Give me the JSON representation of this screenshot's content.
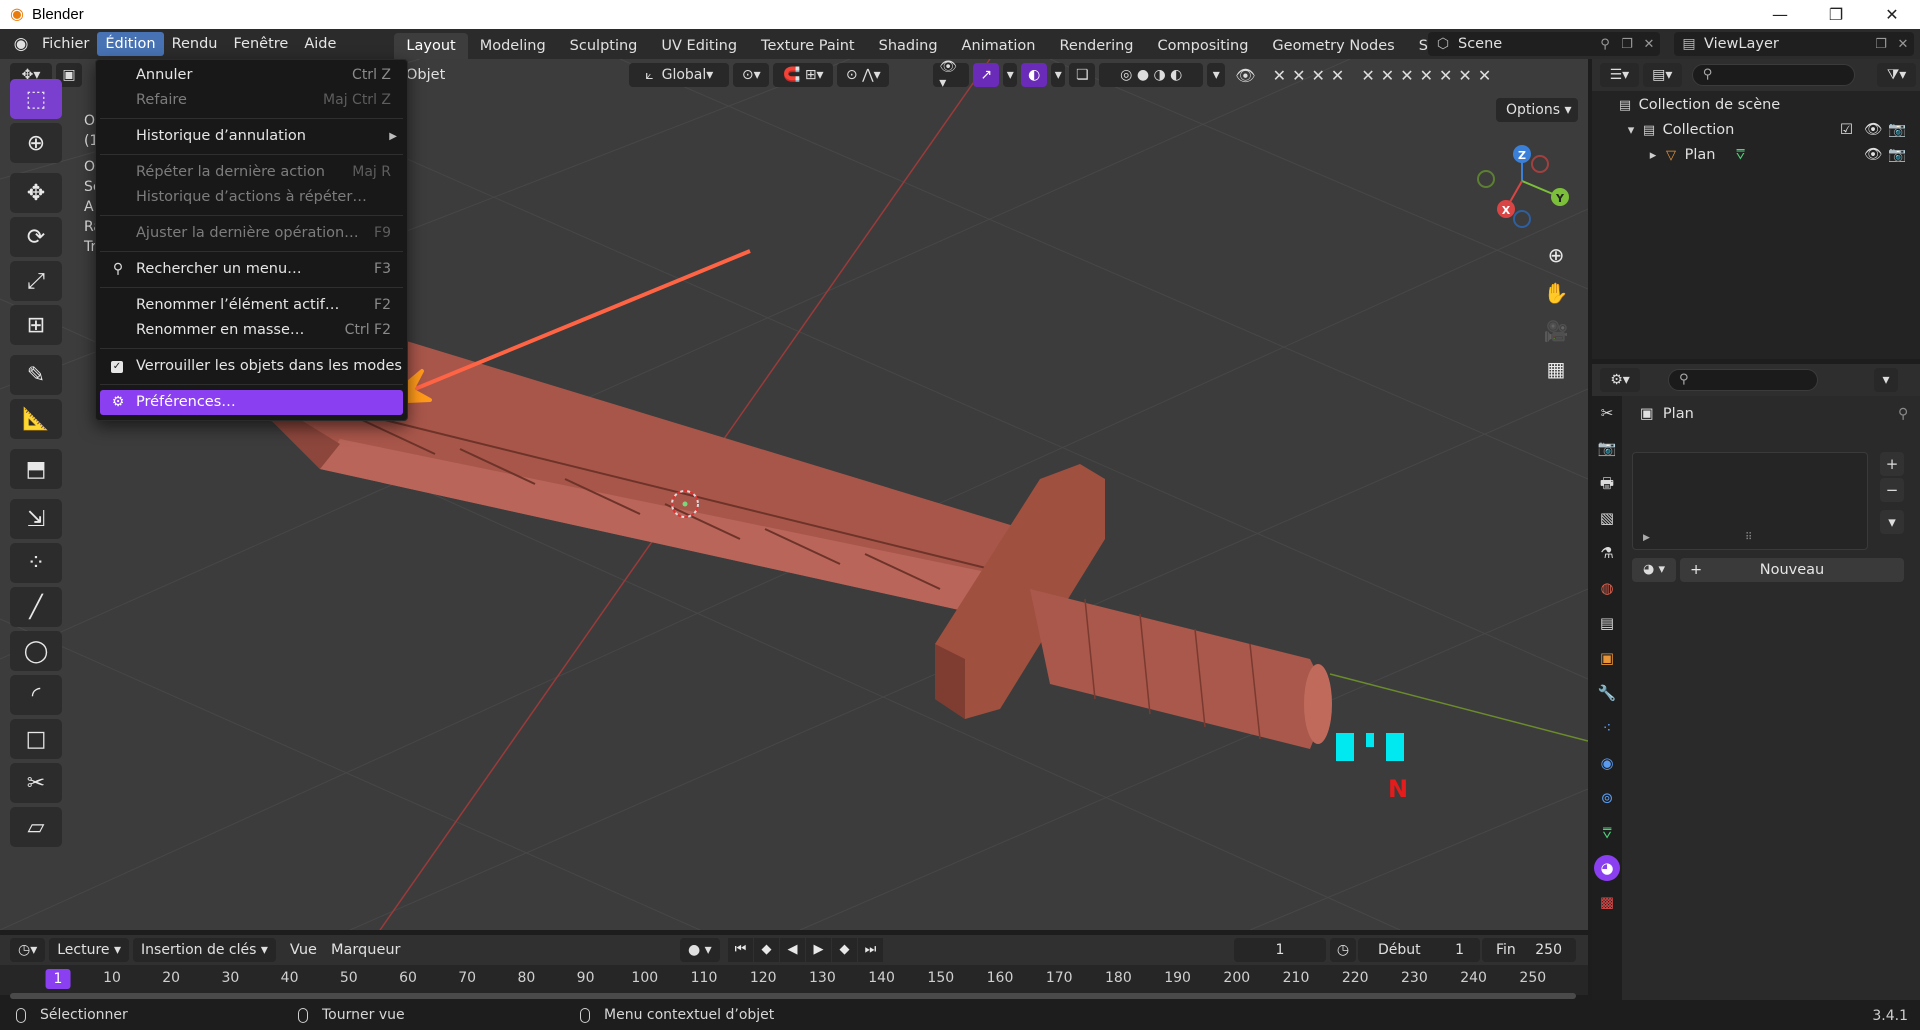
{
  "window": {
    "title": "Blender",
    "btn_min": "—",
    "btn_max": "❐",
    "btn_close": "✕"
  },
  "menubar": {
    "items": [
      "Fichier",
      "Édition",
      "Rendu",
      "Fenêtre",
      "Aide"
    ],
    "active": "Édition"
  },
  "workspaces": {
    "tabs": [
      "Layout",
      "Modeling",
      "Sculpting",
      "UV Editing",
      "Texture Paint",
      "Shading",
      "Animation",
      "Rendering",
      "Compositing",
      "Geometry Nodes",
      "Scripting"
    ],
    "active": "Layout",
    "add": "+"
  },
  "scene": {
    "name": "Scene"
  },
  "view_layer": {
    "name": "ViewLayer"
  },
  "viewport_header": {
    "mode_label": "Objet",
    "transform_orientation": "Global",
    "options_label": "Options"
  },
  "viewport_overlay_text": [
    "O",
    "(1",
    "O",
    "Sc",
    "A",
    "Ra",
    "Tr"
  ],
  "edit_menu": {
    "items": [
      {
        "label": "Annuler",
        "shortcut": "Ctrl Z",
        "disabled": false
      },
      {
        "label": "Refaire",
        "shortcut": "Maj Ctrl Z",
        "disabled": true
      },
      {
        "label": "Historique d’annulation",
        "shortcut": "",
        "disabled": false
      },
      {
        "label": "Répéter la dernière action",
        "shortcut": "Maj R",
        "disabled": true
      },
      {
        "label": "Historique d’actions à répéter…",
        "shortcut": "",
        "disabled": true
      },
      {
        "label": "Ajuster la dernière opération…",
        "shortcut": "F9",
        "disabled": true
      },
      {
        "label": "Rechercher un menu…",
        "shortcut": "F3",
        "disabled": false
      },
      {
        "label": "Renommer l’élément actif…",
        "shortcut": "F2",
        "disabled": false
      },
      {
        "label": "Renommer en masse…",
        "shortcut": "Ctrl F2",
        "disabled": false
      },
      {
        "label": "Verrouiller les objets dans les modes",
        "shortcut": "",
        "disabled": false
      },
      {
        "label": "Préférences…",
        "shortcut": "",
        "disabled": false
      }
    ]
  },
  "annotation": {
    "letter": "N",
    "arrow_color": "#ff9a1a",
    "arrow_color_start": "#ff2d6f"
  },
  "timeline": {
    "playback": "Lecture",
    "keying": "Insertion de clés",
    "view": "Vue",
    "marker": "Marqueur",
    "current_frame": "1",
    "start_label": "Début",
    "start_value": "1",
    "end_label": "Fin",
    "end_value": "250",
    "ruler_current": "1",
    "ruler_numbers": [
      "10",
      "20",
      "30",
      "40",
      "50",
      "60",
      "70",
      "80",
      "90",
      "100",
      "110",
      "120",
      "130",
      "140",
      "150",
      "160",
      "170",
      "180",
      "190",
      "200",
      "210",
      "220",
      "230",
      "240",
      "250"
    ]
  },
  "statusbar": {
    "select": "Sélectionner",
    "rotate": "Tourner vue",
    "context": "Menu contextuel d’objet",
    "version": "3.4.1"
  },
  "outliner": {
    "scene_collection": "Collection de scène",
    "collection": "Collection",
    "object": "Plan"
  },
  "properties": {
    "object_name": "Plan",
    "new_button": "Nouveau"
  },
  "colors": {
    "accent": "#8a3ff0",
    "menu_active": "#4772b3",
    "object_color": "#b05a4e"
  }
}
